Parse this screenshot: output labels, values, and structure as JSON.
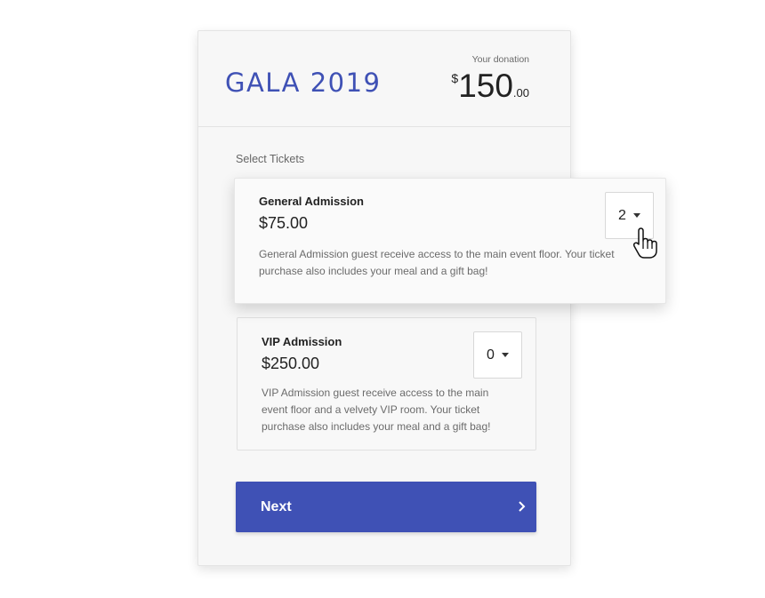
{
  "header": {
    "title": "GALA 2019",
    "donation_label": "Your donation",
    "donation_currency": "$",
    "donation_whole": "150",
    "donation_cents": ".00"
  },
  "tickets": {
    "section_label": "Select Tickets",
    "items": [
      {
        "name": "General Admission",
        "price": "$75.00",
        "description": "General Admission guest receive access to the main event floor. Your ticket purchase also includes your meal and a gift bag!",
        "quantity": "2"
      },
      {
        "name": "VIP Admission",
        "price": "$250.00",
        "description": "VIP Admission guest receive access to the main event floor and a velvety VIP room. Your ticket purchase also includes your meal and a gift bag!",
        "quantity": "0"
      }
    ]
  },
  "actions": {
    "next_label": "Next"
  },
  "icons": {
    "dropdown": "caret-down-icon",
    "next": "chevron-right-icon",
    "cursor": "hand-pointer-icon"
  },
  "colors": {
    "accent": "#3f51b5"
  }
}
